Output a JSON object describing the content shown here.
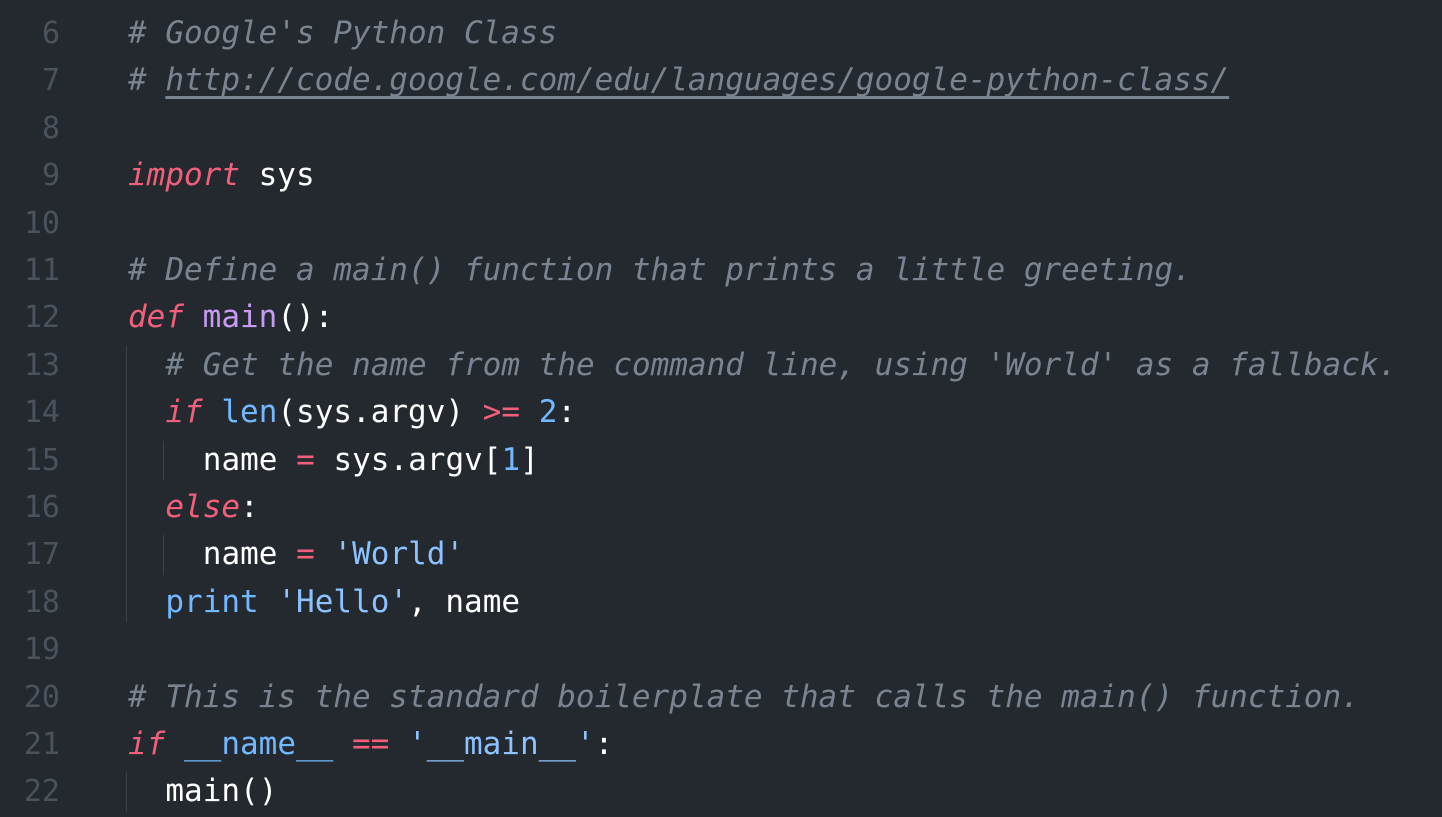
{
  "editor": {
    "lines": [
      {
        "num": "6",
        "indent": 0,
        "tokens": [
          {
            "c": "com",
            "t": "# Google's Python Class"
          }
        ]
      },
      {
        "num": "7",
        "indent": 0,
        "tokens": [
          {
            "c": "com",
            "t": "# "
          },
          {
            "c": "url",
            "t": "http://code.google.com/edu/languages/google-python-class/"
          }
        ]
      },
      {
        "num": "8",
        "indent": 0,
        "tokens": []
      },
      {
        "num": "9",
        "indent": 0,
        "tokens": [
          {
            "c": "kw",
            "t": "import"
          },
          {
            "c": "txt",
            "t": " sys"
          }
        ]
      },
      {
        "num": "10",
        "indent": 0,
        "tokens": []
      },
      {
        "num": "11",
        "indent": 0,
        "tokens": [
          {
            "c": "com",
            "t": "# Define a main() function that prints a little greeting."
          }
        ]
      },
      {
        "num": "12",
        "indent": 0,
        "tokens": [
          {
            "c": "kw",
            "t": "def"
          },
          {
            "c": "txt",
            "t": " "
          },
          {
            "c": "fn",
            "t": "main"
          },
          {
            "c": "txt",
            "t": "():"
          }
        ]
      },
      {
        "num": "13",
        "indent": 1,
        "tokens": [
          {
            "c": "com",
            "t": "# Get the name from the command line, using 'World' as a fallback."
          }
        ]
      },
      {
        "num": "14",
        "indent": 1,
        "tokens": [
          {
            "c": "kw",
            "t": "if"
          },
          {
            "c": "txt",
            "t": " "
          },
          {
            "c": "bi",
            "t": "len"
          },
          {
            "c": "txt",
            "t": "(sys.argv) "
          },
          {
            "c": "op",
            "t": ">="
          },
          {
            "c": "txt",
            "t": " "
          },
          {
            "c": "num",
            "t": "2"
          },
          {
            "c": "txt",
            "t": ":"
          }
        ]
      },
      {
        "num": "15",
        "indent": 2,
        "tokens": [
          {
            "c": "txt",
            "t": "name "
          },
          {
            "c": "op",
            "t": "="
          },
          {
            "c": "txt",
            "t": " sys.argv["
          },
          {
            "c": "num",
            "t": "1"
          },
          {
            "c": "txt",
            "t": "]"
          }
        ]
      },
      {
        "num": "16",
        "indent": 1,
        "tokens": [
          {
            "c": "kw",
            "t": "else"
          },
          {
            "c": "txt",
            "t": ":"
          }
        ]
      },
      {
        "num": "17",
        "indent": 2,
        "tokens": [
          {
            "c": "txt",
            "t": "name "
          },
          {
            "c": "op",
            "t": "="
          },
          {
            "c": "txt",
            "t": " "
          },
          {
            "c": "str",
            "t": "'World'"
          }
        ]
      },
      {
        "num": "18",
        "indent": 1,
        "tokens": [
          {
            "c": "bi",
            "t": "print"
          },
          {
            "c": "txt",
            "t": " "
          },
          {
            "c": "str",
            "t": "'Hello'"
          },
          {
            "c": "txt",
            "t": ", name"
          }
        ]
      },
      {
        "num": "19",
        "indent": 0,
        "tokens": []
      },
      {
        "num": "20",
        "indent": 0,
        "tokens": [
          {
            "c": "com",
            "t": "# This is the standard boilerplate that calls the main() function."
          }
        ]
      },
      {
        "num": "21",
        "indent": 0,
        "tokens": [
          {
            "c": "kw",
            "t": "if"
          },
          {
            "c": "txt",
            "t": " "
          },
          {
            "c": "bi",
            "t": "__name__"
          },
          {
            "c": "txt",
            "t": " "
          },
          {
            "c": "op",
            "t": "=="
          },
          {
            "c": "txt",
            "t": " "
          },
          {
            "c": "str",
            "t": "'__main__'"
          },
          {
            "c": "txt",
            "t": ":"
          }
        ]
      },
      {
        "num": "22",
        "indent": 1,
        "tokens": [
          {
            "c": "txt",
            "t": "main()"
          }
        ]
      }
    ]
  }
}
